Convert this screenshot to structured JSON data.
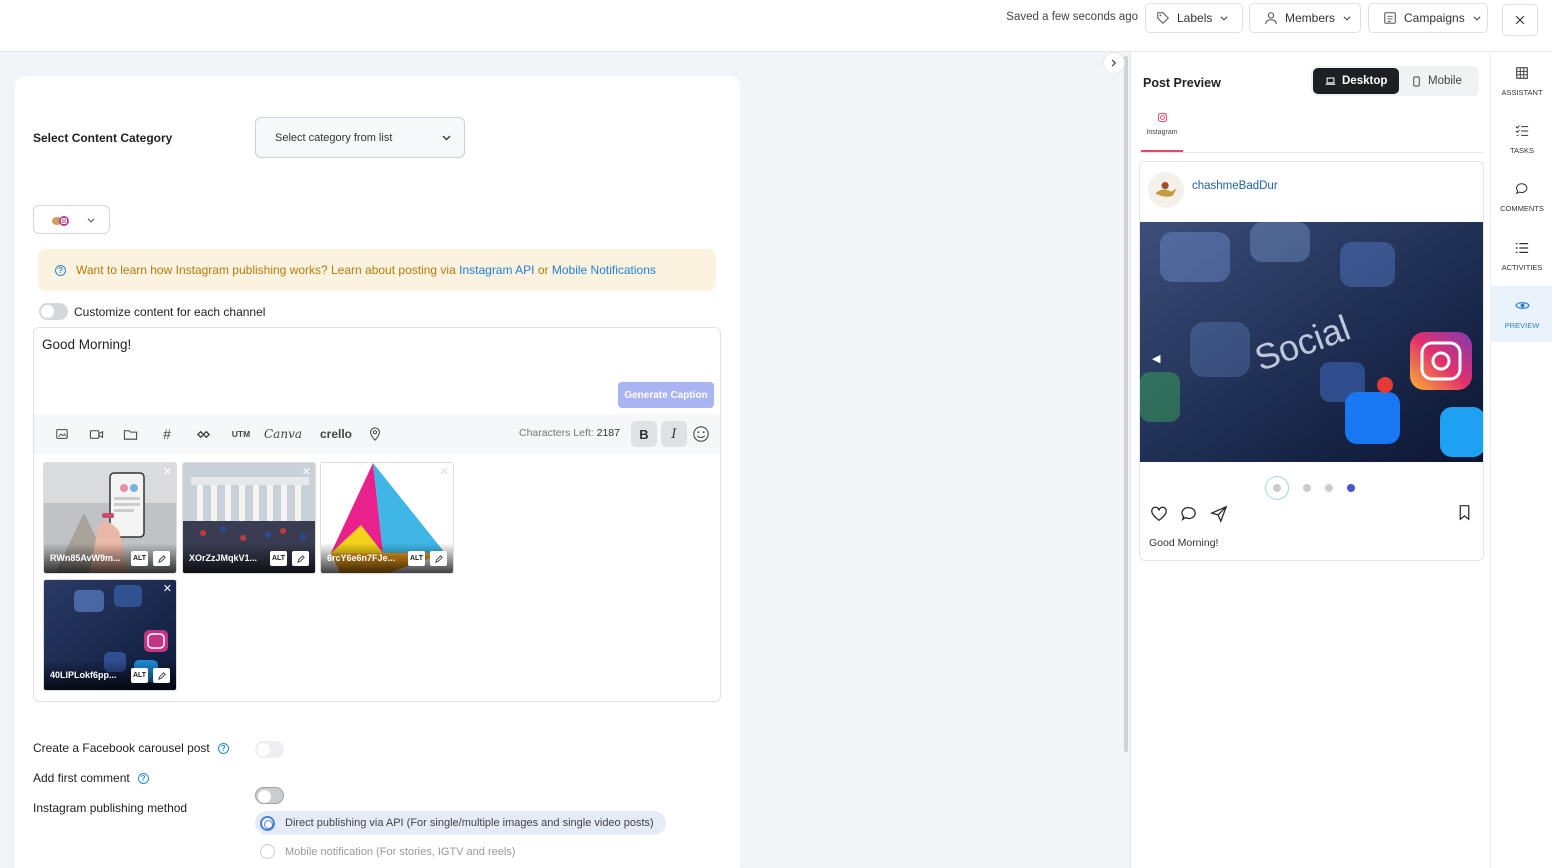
{
  "topbar": {
    "saved_text": "Saved a few seconds ago",
    "labels_btn": "Labels",
    "members_btn": "Members",
    "campaigns_btn": "Campaigns"
  },
  "composer": {
    "category_label": "Select Content Category",
    "category_placeholder": "Select category from list",
    "info_banner": {
      "prefix": "Want to learn how Instagram publishing works? Learn about posting via",
      "link1": "Instagram API",
      "middle": "or",
      "link2": "Mobile Notifications"
    },
    "customize_label": "Customize content for each channel",
    "post_text": "Good Morning!",
    "generate_caption": "Generate Caption",
    "toolbar": {
      "utm": "UTM",
      "canva": "Canva",
      "crello": "crello",
      "chars_label": "Characters Left:",
      "chars_value": "2187",
      "bold": "B",
      "italic": "I"
    },
    "media": [
      {
        "name": "RWn85AvW9m...",
        "alt": "ALT"
      },
      {
        "name": "XOrZzJMqkV1...",
        "alt": "ALT"
      },
      {
        "name": "6rcY6e6n7FJe...",
        "alt": "ALT"
      },
      {
        "name": "40LlPLokf6pp...",
        "alt": "ALT"
      }
    ],
    "fb_carousel_label": "Create a Facebook carousel post",
    "first_comment_label": "Add first comment",
    "publishing_method_label": "Instagram publishing method",
    "method_direct": "Direct publishing via API (For single/multiple images and single video posts)",
    "method_mobile": "Mobile notification (For stories, IGTV and reels)"
  },
  "preview": {
    "title": "Post Preview",
    "desktop": "Desktop",
    "mobile": "Mobile",
    "tab_instagram": "Instagram",
    "username": "chashmeBadDur",
    "caption": "Good Morning!",
    "carousel": {
      "count": 4,
      "active_index": 3
    }
  },
  "sidebar": {
    "items": [
      {
        "label": "ASSISTANT",
        "icon": "grid-icon"
      },
      {
        "label": "TASKS",
        "icon": "tasks-icon"
      },
      {
        "label": "COMMENTS",
        "icon": "comment-icon"
      },
      {
        "label": "ACTIVITIES",
        "icon": "list-icon"
      },
      {
        "label": "PREVIEW",
        "icon": "eye-icon"
      }
    ]
  },
  "colors": {
    "accent": "#2b7fd4",
    "banner_bg": "#fbf3df",
    "banner_text": "#b57a0a",
    "generate_btn": "#aab4f3",
    "instagram": "#e24a6a"
  }
}
